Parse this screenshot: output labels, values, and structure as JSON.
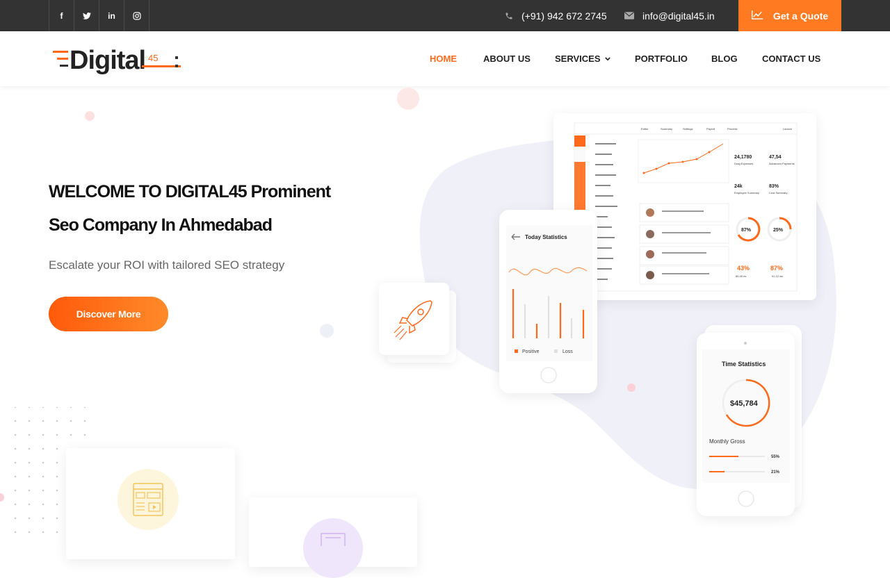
{
  "topbar": {
    "social": [
      {
        "icon": "facebook-icon",
        "glyph": "f"
      },
      {
        "icon": "twitter-icon",
        "glyph": "t"
      },
      {
        "icon": "linkedin-icon",
        "glyph": "in"
      },
      {
        "icon": "instagram-icon",
        "glyph": "◎"
      }
    ],
    "phone": "(+91) 942 672 2745",
    "email": "info@digital45.in",
    "quote_label": "Get a Quote"
  },
  "brand": {
    "name": "Digital",
    "suffix": "45",
    "accent": "#ff6a1a",
    "dark": "#333333"
  },
  "nav": {
    "home": "HOME",
    "about": "ABOUT US",
    "services": "SERVICES",
    "portfolio": "PORTFOLIO",
    "blog": "BLOG",
    "contact": "CONTACT US"
  },
  "hero": {
    "title_line1": "WELCOME TO DIGITAL45 Prominent",
    "title_line2": "Seo Company In Ahmedabad",
    "subtitle": "Escalate your ROI with tailored SEO strategy",
    "cta": "Discover More"
  },
  "dashboard": {
    "tabs": [
      "Editor",
      "Summary",
      "Settings",
      "Payroll",
      "Process",
      "Launch"
    ],
    "stats": [
      {
        "value": "24,1780",
        "label": "Drag Expenses"
      },
      {
        "value": "47,54",
        "label": "Advanced Payments"
      },
      {
        "value": "24k",
        "label": "Employee Summary"
      },
      {
        "value": "83%",
        "label": "Cost Summary"
      }
    ],
    "ring1": "87%",
    "ring2": "25%",
    "foot1": "43%",
    "foot1_sub": "85.45 es",
    "foot2": "87%",
    "foot2_sub": "51.12 ws"
  },
  "phone1": {
    "title": "Today Statistics",
    "legend1": "Positive",
    "legend2": "Loss"
  },
  "phone2": {
    "title": "Time Statistics",
    "amount": "$45,784",
    "label": "Monthly Gross",
    "bar1": "55%",
    "bar2": "21%"
  }
}
